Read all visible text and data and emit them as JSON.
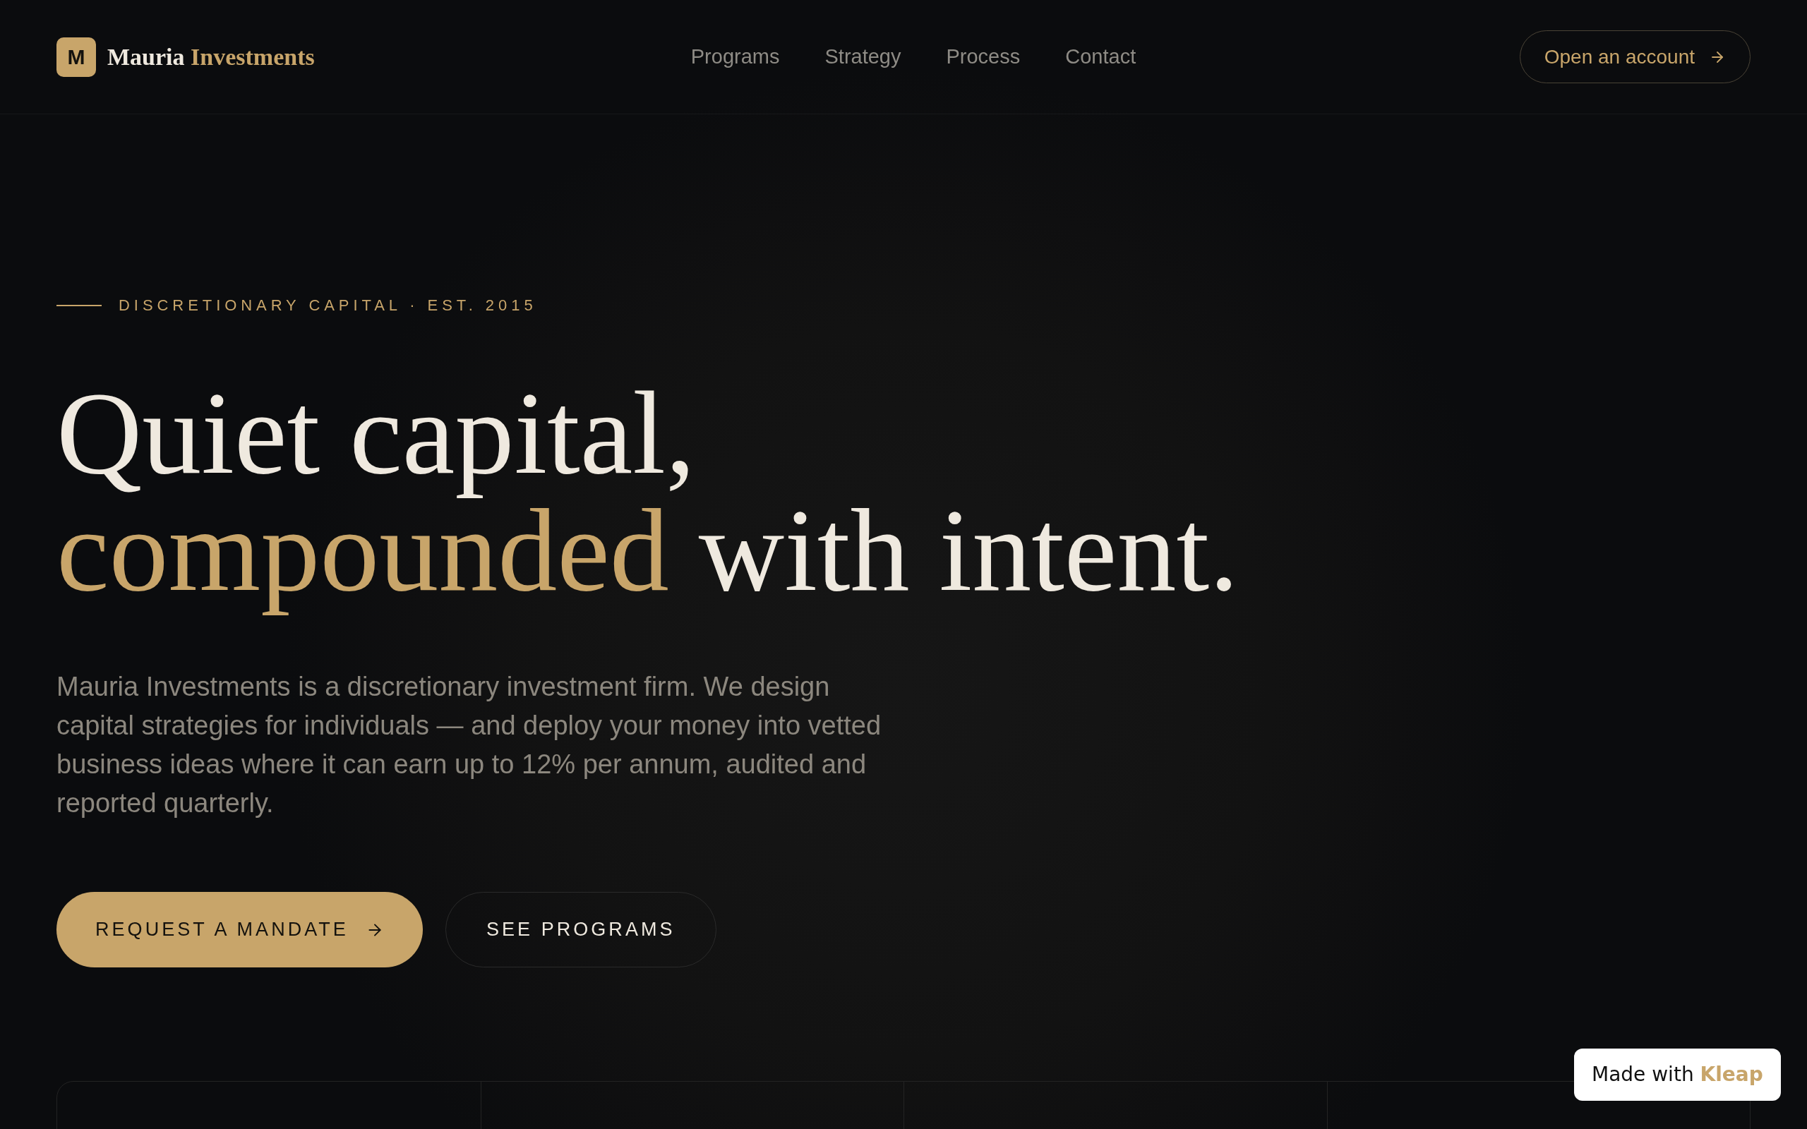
{
  "header": {
    "logo_mark": "M",
    "brand": {
      "name": "Mauria",
      "accent": "Investments"
    },
    "nav": [
      {
        "label": "Programs"
      },
      {
        "label": "Strategy"
      },
      {
        "label": "Process"
      },
      {
        "label": "Contact"
      }
    ],
    "cta": {
      "label": "Open an account"
    }
  },
  "hero": {
    "eyebrow": "DISCRETIONARY CAPITAL · EST. 2015",
    "headline": {
      "line_1": "Quiet capital,",
      "accent": "compounded",
      "rest": "with intent."
    },
    "intro": "Mauria Investments is a discretionary investment firm. We design capital strategies for individuals — and deploy your money into vetted business ideas where it can earn up to 12% per annum, audited and reported quarterly.",
    "buttons": [
      {
        "label": "REQUEST A MANDATE",
        "kind": "primary"
      },
      {
        "label": "SEE PROGRAMS",
        "kind": "secondary"
      }
    ]
  },
  "badge": {
    "text": "Made with **Kleap**"
  }
}
